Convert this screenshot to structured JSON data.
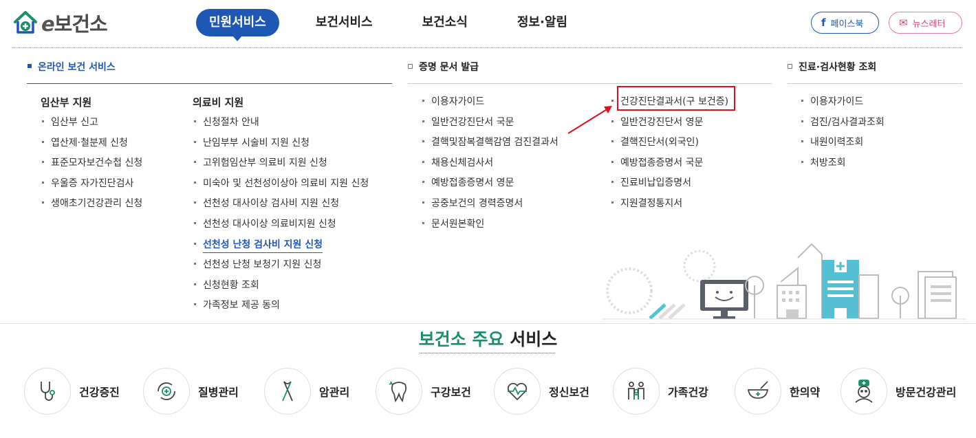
{
  "header": {
    "logo": {
      "e": "e",
      "text": "보건소"
    },
    "nav": [
      "민원서비스",
      "보건서비스",
      "보건소식",
      "정보·알림"
    ],
    "active_nav": "민원서비스",
    "facebook": {
      "icon": "f",
      "label": "페이스북"
    },
    "newsletter": {
      "icon": "✉",
      "label": "뉴스레터"
    }
  },
  "columns": {
    "online": {
      "title": "온라인 보건 서비스",
      "pregnancy": {
        "title": "임산부 지원",
        "items": [
          "임산부 신고",
          "엽산제·철분제 신청",
          "표준모자보건수첩 신청",
          "우울증 자가진단검사",
          "생애초기건강관리 신청"
        ]
      },
      "medical": {
        "title": "의료비 지원",
        "items": [
          "신청절차 안내",
          "난임부부 시술비 지원 신청",
          "고위험임산부 의료비 지원 신청",
          "미숙아 및 선천성이상아 의료비 지원 신청",
          "선천성 대사이상 검사비 지원 신청",
          "선천성 대사이상 의료비지원 신청",
          "선천성 난청 검사비 지원 신청",
          "선천성 난청 보청기 지원 신청",
          "신청현황 조회",
          "가족정보 제공 동의"
        ],
        "selected": "선천성 난청 검사비 지원 신청"
      }
    },
    "certificates": {
      "title": "증명 문서 발급",
      "left_items": [
        "이용자가이드",
        "일반건강진단서 국문",
        "결핵및잠복결핵감염 검진결과서",
        "채용신체검사서",
        "예방접종증명서 영문",
        "공중보건의 경력증명서",
        "문서원본확인"
      ],
      "right_items": [
        "건강진단결과서(구 보건증)",
        "일반건강진단서 영문",
        "결핵진단서(외국인)",
        "예방접종증명서 국문",
        "진료비납입증명서",
        "지원결정통지서"
      ]
    },
    "records": {
      "title": "진료·검사현황 조회",
      "items": [
        "이용자가이드",
        "검진/검사결과조회",
        "내원이력조회",
        "처방조회"
      ]
    }
  },
  "main_services": {
    "title_green": "보건소 주요",
    "title_dark": "서비스",
    "items": [
      {
        "label": "건강증진",
        "icon": "stethoscope-icon"
      },
      {
        "label": "질병관리",
        "icon": "virus-cycle-icon"
      },
      {
        "label": "암관리",
        "icon": "ribbon-icon"
      },
      {
        "label": "구강보건",
        "icon": "tooth-icon"
      },
      {
        "label": "정신보건",
        "icon": "heart-pulse-icon"
      },
      {
        "label": "가족건강",
        "icon": "family-icon"
      },
      {
        "label": "한의약",
        "icon": "mortar-icon"
      },
      {
        "label": "방문건강관리",
        "icon": "nurse-icon"
      }
    ]
  },
  "colors": {
    "brand": "#1f57b5",
    "green": "#1b8e6b",
    "highlight": "#e0101a"
  }
}
